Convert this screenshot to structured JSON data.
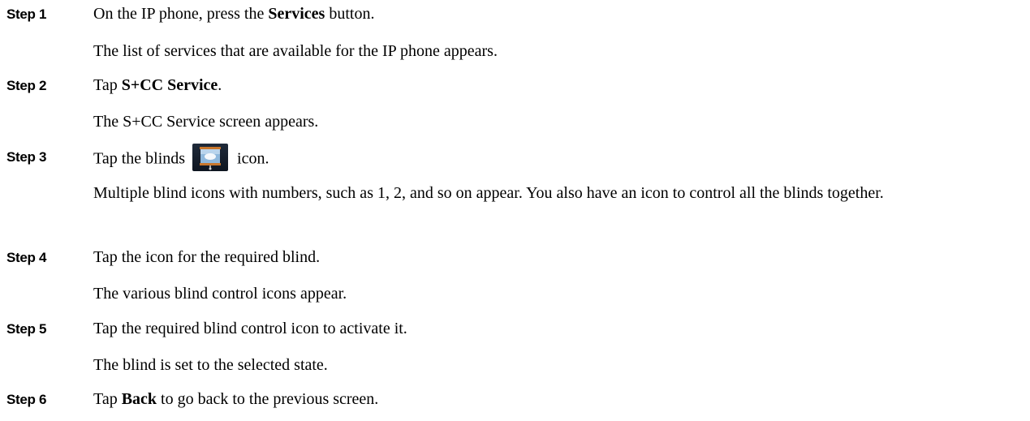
{
  "steps": [
    {
      "label": "Step 1",
      "instruction_pre": "On the IP phone, press the ",
      "instruction_bold": "Services",
      "instruction_post": " button.",
      "result": "The list of services that are available for the IP phone appears."
    },
    {
      "label": "Step 2",
      "instruction_pre": "Tap ",
      "instruction_bold": "S+CC Service",
      "instruction_post": ".",
      "result": "The S+CC Service screen appears."
    },
    {
      "label": "Step 3",
      "instruction_pre": "Tap the blinds ",
      "icon": "blinds-icon",
      "instruction_post": " icon.",
      "result": "Multiple blind icons with numbers, such as 1, 2, and so on appear. You also have an icon to control all the blinds together."
    },
    {
      "label": "Step 4",
      "instruction": "Tap the icon for the required blind.",
      "result": "The various blind control icons appear."
    },
    {
      "label": "Step 5",
      "instruction": "Tap the required blind control icon to activate it.",
      "result": "The blind is set to the selected state."
    },
    {
      "label": "Step 6",
      "instruction_pre": "Tap ",
      "instruction_bold": "Back",
      "instruction_post": " to go back to the previous screen."
    }
  ]
}
